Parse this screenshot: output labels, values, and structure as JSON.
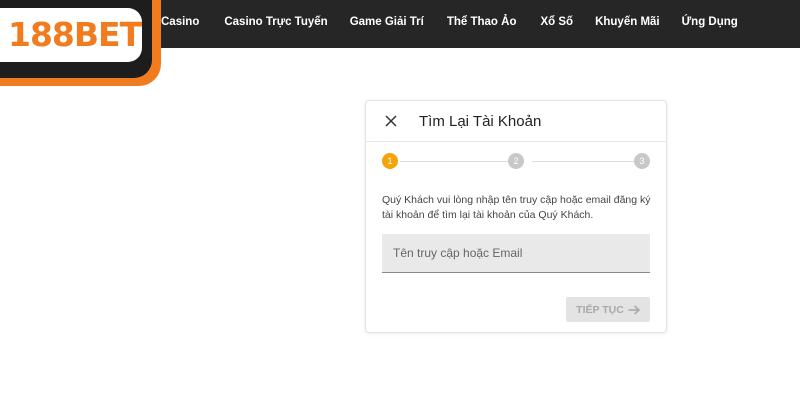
{
  "brand": {
    "logo_text": "188BET",
    "accent": "#f07c1f"
  },
  "nav": {
    "items": [
      {
        "label": "Casino"
      },
      {
        "label": "Casino Trực Tuyến"
      },
      {
        "label": "Game Giải Trí"
      },
      {
        "label": "Thể Thao Ảo"
      },
      {
        "label": "Xổ Số"
      },
      {
        "label": "Khuyến Mãi"
      },
      {
        "label": "Ứng Dụng"
      }
    ]
  },
  "dialog": {
    "title": "Tìm Lại Tài Khoản",
    "close_icon": "close-icon",
    "steps": [
      "1",
      "2",
      "3"
    ],
    "active_step": 1,
    "description": "Quý Khách vui lòng nhập tên truy cập hoặc email đăng ký tài khoản để tìm lại tài khoản của Quý Khách.",
    "input": {
      "value": "",
      "placeholder": "Tên truy cập hoặc Email"
    },
    "continue_label": "TIẾP TỤC",
    "continue_icon": "arrow-right-icon"
  }
}
